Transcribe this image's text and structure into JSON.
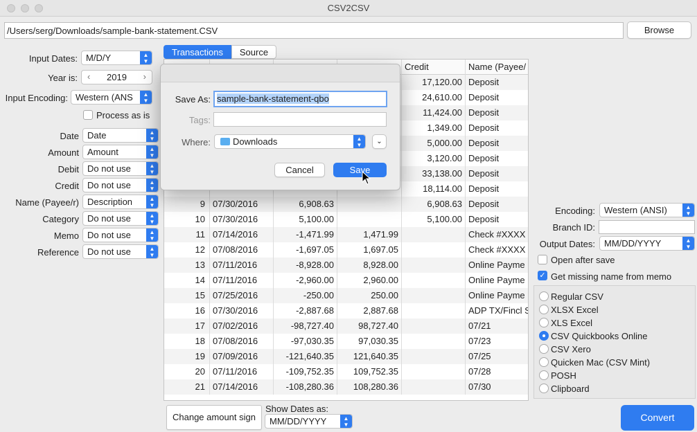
{
  "window": {
    "title": "CSV2CSV"
  },
  "file": {
    "path": "/Users/serg/Downloads/sample-bank-statement.CSV",
    "browse_label": "Browse"
  },
  "left": {
    "input_dates_label": "Input Dates:",
    "input_dates_value": "M/D/Y",
    "year_label": "Year is:",
    "year_value": "2019",
    "encoding_label": "Input Encoding:",
    "encoding_value": "Western (ANS",
    "process_as_is": "Process as is",
    "mappings": [
      {
        "label": "Date",
        "value": "Date"
      },
      {
        "label": "Amount",
        "value": "Amount"
      },
      {
        "label": "Debit",
        "value": "Do not use"
      },
      {
        "label": "Credit",
        "value": "Do not use"
      },
      {
        "label": "Name (Payee/r)",
        "value": "Description"
      },
      {
        "label": "Category",
        "value": "Do not use"
      },
      {
        "label": "Memo",
        "value": "Do not use"
      },
      {
        "label": "Reference",
        "value": "Do not use"
      }
    ]
  },
  "tabs": {
    "transactions": "Transactions",
    "source": "Source"
  },
  "table": {
    "headers": {
      "credit": "Credit",
      "name": "Name (Payee/"
    },
    "rows": [
      {
        "n": "",
        "date": "",
        "amount": "",
        "debit": "",
        "credit": "17,120.00",
        "name": "Deposit"
      },
      {
        "n": "",
        "date": "",
        "amount": "",
        "debit": "",
        "credit": "24,610.00",
        "name": "Deposit"
      },
      {
        "n": "",
        "date": "",
        "amount": "",
        "debit": "",
        "credit": "11,424.00",
        "name": "Deposit"
      },
      {
        "n": "",
        "date": "",
        "amount": "",
        "debit": "",
        "credit": "1,349.00",
        "name": "Deposit"
      },
      {
        "n": "",
        "date": "",
        "amount": "",
        "debit": "",
        "credit": "5,000.00",
        "name": "Deposit"
      },
      {
        "n": "",
        "date": "",
        "amount": "",
        "debit": "",
        "credit": "3,120.00",
        "name": "Deposit"
      },
      {
        "n": "",
        "date": "",
        "amount": "",
        "debit": "",
        "credit": "33,138.00",
        "name": "Deposit"
      },
      {
        "n": "",
        "date": "",
        "amount": "",
        "debit": "",
        "credit": "18,114.00",
        "name": "Deposit"
      },
      {
        "n": "9",
        "date": "07/30/2016",
        "amount": "6,908.63",
        "debit": "",
        "credit": "6,908.63",
        "name": "Deposit"
      },
      {
        "n": "10",
        "date": "07/30/2016",
        "amount": "5,100.00",
        "debit": "",
        "credit": "5,100.00",
        "name": "Deposit"
      },
      {
        "n": "11",
        "date": "07/14/2016",
        "amount": "-1,471.99",
        "debit": "1,471.99",
        "credit": "",
        "name": "Check #XXXX"
      },
      {
        "n": "12",
        "date": "07/08/2016",
        "amount": "-1,697.05",
        "debit": "1,697.05",
        "credit": "",
        "name": "Check #XXXX"
      },
      {
        "n": "13",
        "date": "07/11/2016",
        "amount": "-8,928.00",
        "debit": "8,928.00",
        "credit": "",
        "name": "Online Payme"
      },
      {
        "n": "14",
        "date": "07/11/2016",
        "amount": "-2,960.00",
        "debit": "2,960.00",
        "credit": "",
        "name": "Online Payme"
      },
      {
        "n": "15",
        "date": "07/25/2016",
        "amount": "-250.00",
        "debit": "250.00",
        "credit": "",
        "name": "Online Payme"
      },
      {
        "n": "16",
        "date": "07/30/2016",
        "amount": "-2,887.68",
        "debit": "2,887.68",
        "credit": "",
        "name": "ADP TX/Fincl S"
      },
      {
        "n": "17",
        "date": "07/02/2016",
        "amount": "-98,727.40",
        "debit": "98,727.40",
        "credit": "",
        "name": "07/21"
      },
      {
        "n": "18",
        "date": "07/08/2016",
        "amount": "-97,030.35",
        "debit": "97,030.35",
        "credit": "",
        "name": "07/23"
      },
      {
        "n": "19",
        "date": "07/09/2016",
        "amount": "-121,640.35",
        "debit": "121,640.35",
        "credit": "",
        "name": "07/25"
      },
      {
        "n": "20",
        "date": "07/11/2016",
        "amount": "-109,752.35",
        "debit": "109,752.35",
        "credit": "",
        "name": "07/28"
      },
      {
        "n": "21",
        "date": "07/14/2016",
        "amount": "-108,280.36",
        "debit": "108,280.36",
        "credit": "",
        "name": "07/30"
      }
    ]
  },
  "bottom": {
    "change_sign": "Change amount sign",
    "show_dates_label": "Show Dates as:",
    "show_dates_value": "MM/DD/YYYY",
    "convert": "Convert"
  },
  "right": {
    "encoding_label": "Encoding:",
    "encoding_value": "Western (ANSI)",
    "branch_label": "Branch ID:",
    "branch_value": "",
    "output_dates_label": "Output Dates:",
    "output_dates_value": "MM/DD/YYYY",
    "open_after_save": "Open after save",
    "get_missing_name": "Get missing name from memo",
    "formats": [
      "Regular CSV",
      "XLSX Excel",
      "XLS Excel",
      "CSV Quickbooks Online",
      "CSV Xero",
      "Quicken Mac (CSV Mint)",
      "POSH",
      "Clipboard"
    ],
    "selected_format": "CSV Quickbooks Online"
  },
  "dialog": {
    "save_as_label": "Save As:",
    "save_as_value": "sample-bank-statement-qbo",
    "tags_label": "Tags:",
    "tags_value": "",
    "where_label": "Where:",
    "where_value": "Downloads",
    "cancel": "Cancel",
    "save": "Save"
  },
  "colors": {
    "accent": "#2f7cf0",
    "highlight": "#b3d3f9"
  }
}
